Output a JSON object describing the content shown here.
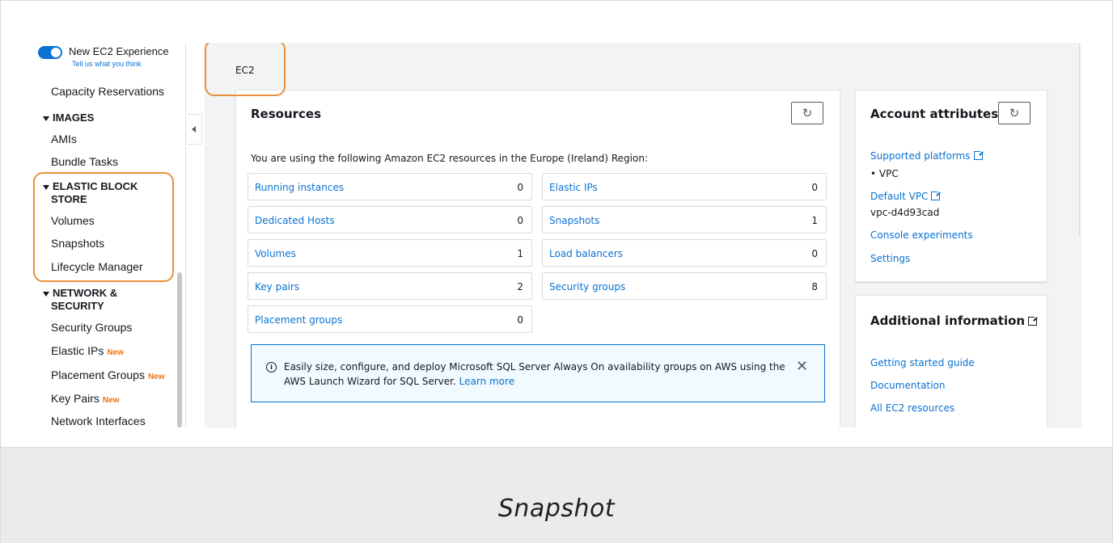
{
  "sidebar": {
    "toggle_title": "New EC2 Experience",
    "toggle_sub": "Tell us what you think",
    "capacity": "Capacity Reservations",
    "images_head": "IMAGES",
    "amis": "AMIs",
    "bundle": "Bundle Tasks",
    "ebs_head_1": "ELASTIC BLOCK",
    "ebs_head_2": "STORE",
    "volumes": "Volumes",
    "snapshots": "Snapshots",
    "lifecycle": "Lifecycle Manager",
    "net_head_1": "NETWORK &",
    "net_head_2": "SECURITY",
    "security_groups": "Security Groups",
    "elastic_ips": "Elastic IPs",
    "placement_groups": "Placement Groups",
    "key_pairs": "Key Pairs",
    "network_interfaces": "Network Interfaces",
    "new_tag": "New"
  },
  "breadcrumb": "EC2",
  "resources": {
    "title": "Resources",
    "intro": "You are using the following Amazon EC2 resources in the Europe (Ireland) Region:",
    "items": [
      {
        "label": "Running instances",
        "value": "0"
      },
      {
        "label": "Elastic IPs",
        "value": "0"
      },
      {
        "label": "Dedicated Hosts",
        "value": "0"
      },
      {
        "label": "Snapshots",
        "value": "1"
      },
      {
        "label": "Volumes",
        "value": "1"
      },
      {
        "label": "Load balancers",
        "value": "0"
      },
      {
        "label": "Key pairs",
        "value": "2"
      },
      {
        "label": "Security groups",
        "value": "8"
      },
      {
        "label": "Placement groups",
        "value": "0"
      }
    ],
    "info_text": "Easily size, configure, and deploy Microsoft SQL Server Always On availability groups on AWS using the AWS Launch Wizard for SQL Server.",
    "info_link": "Learn more"
  },
  "account": {
    "title": "Account attributes",
    "supported_platforms": "Supported platforms",
    "vpc_bullet": "• VPC",
    "default_vpc": "Default VPC",
    "vpc_id": "vpc-d4d93cad",
    "console_experiments": "Console experiments",
    "settings": "Settings"
  },
  "additional": {
    "title": "Additional information",
    "getting_started": "Getting started guide",
    "documentation": "Documentation",
    "all_resources": "All EC2 resources"
  },
  "caption": "Snapshot",
  "icons": {
    "refresh": "refresh-icon",
    "info": "info-icon",
    "close": "close-icon",
    "external": "external-link-icon"
  },
  "colors": {
    "link": "#0972d3",
    "highlight": "#e8913a",
    "new_tag": "#ec7211"
  }
}
